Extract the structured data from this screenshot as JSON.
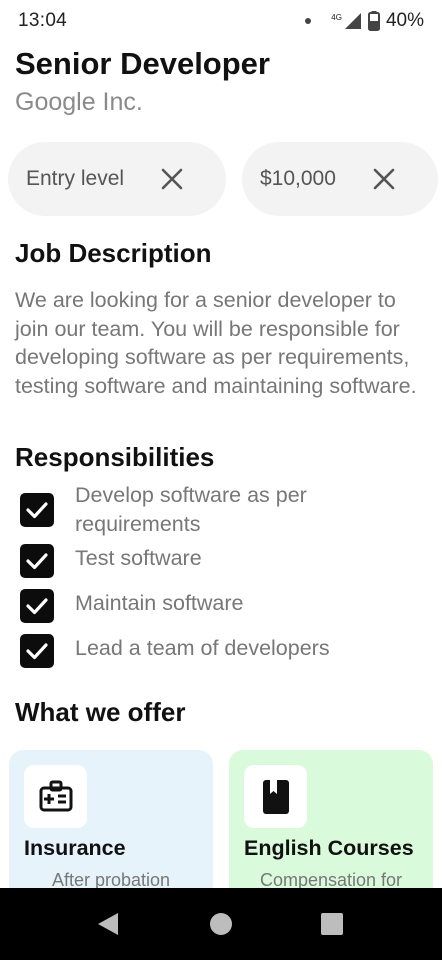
{
  "status_bar": {
    "time": "13:04",
    "network": "4G",
    "battery": "40%"
  },
  "job": {
    "title": "Senior Developer",
    "company": "Google Inc."
  },
  "chips": [
    {
      "label": "Entry level"
    },
    {
      "label": "$10,000"
    }
  ],
  "description": {
    "heading": "Job Description",
    "text": "We are looking for a senior developer to join our team. You will be responsible for developing software as per requirements, testing software and maintaining software."
  },
  "responsibilities": {
    "heading": "Responsibilities",
    "items": [
      {
        "label": "Develop software as per requirements",
        "checked": true
      },
      {
        "label": "Test software",
        "checked": true
      },
      {
        "label": "Maintain software",
        "checked": true
      },
      {
        "label": "Lead a team of developers",
        "checked": true
      }
    ]
  },
  "offers": {
    "heading": "What we offer",
    "cards": [
      {
        "title": "Insurance",
        "subtitle": "After probation",
        "icon": "medical-id-icon",
        "color": "#e7f3fb"
      },
      {
        "title": "English Courses",
        "subtitle": "Compensation for",
        "icon": "book-icon",
        "color": "#dafadc"
      }
    ]
  }
}
